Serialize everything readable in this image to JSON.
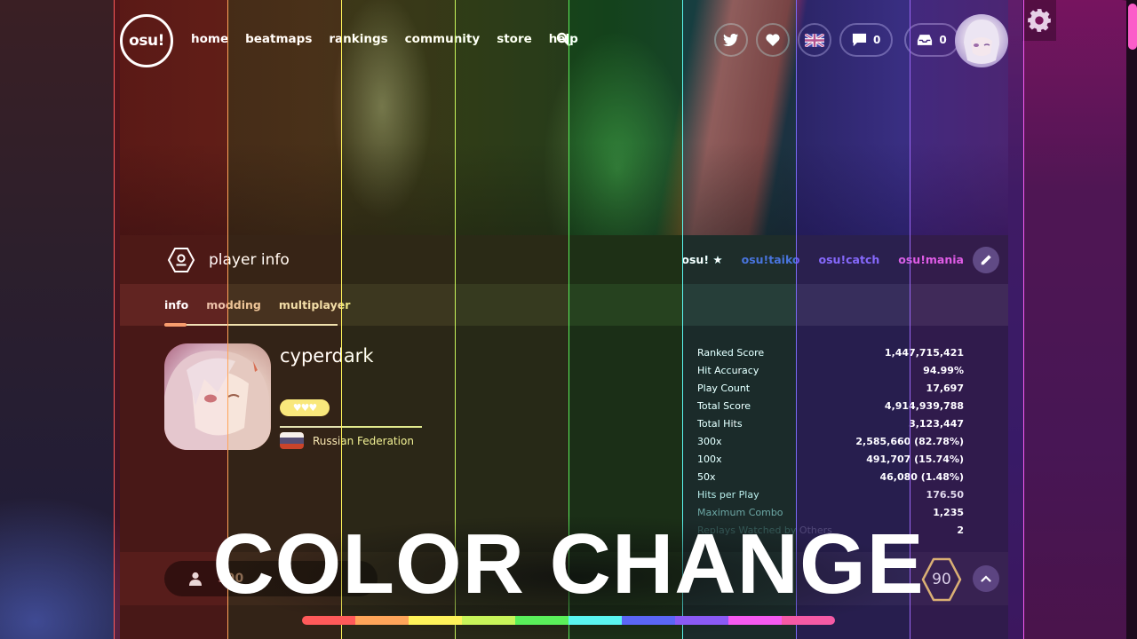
{
  "nav": {
    "logo": "osu!",
    "links": [
      "home",
      "beatmaps",
      "rankings",
      "community",
      "store",
      "help"
    ],
    "search_icon": "search-icon",
    "right": {
      "twitter_icon": "twitter-icon",
      "heart_icon": "heart-icon",
      "language_flag": "uk-flag-icon",
      "chat_count": "0",
      "notifications_count": "0"
    },
    "settings_icon": "gear-icon"
  },
  "panel": {
    "title": "player info",
    "modes": [
      {
        "label": "osu!",
        "color": "#ffffff",
        "active": true
      },
      {
        "label": "osu!taiko",
        "color": "#6c5cff"
      },
      {
        "label": "osu!catch",
        "color": "#8a66ff"
      },
      {
        "label": "osu!mania",
        "color": "#ff4fd8"
      }
    ],
    "tabs": [
      {
        "label": "info",
        "color": "#ffffff",
        "active": true
      },
      {
        "label": "modding",
        "color": "#e0c9a4"
      },
      {
        "label": "multiplayer",
        "color": "#e7e3a8"
      }
    ],
    "user": {
      "username": "cyperdark",
      "supporter_hearts": "♥♥♥",
      "country": "Russian Federation"
    },
    "stats": [
      {
        "key": "Ranked Score",
        "value": "1,447,715,421"
      },
      {
        "key": "Hit Accuracy",
        "value": "94.99%"
      },
      {
        "key": "Play Count",
        "value": "17,697"
      },
      {
        "key": "Total Score",
        "value": "4,914,939,788"
      },
      {
        "key": "Total Hits",
        "value": "3,123,447"
      },
      {
        "key": "300x",
        "value": "2,585,660 (82.78%)"
      },
      {
        "key": "100x",
        "value": "491,707 (15.74%)"
      },
      {
        "key": "50x",
        "value": "46,080 (1.48%)"
      },
      {
        "key": "Hits per Play",
        "value": "176.50"
      },
      {
        "key": "Maximum Combo",
        "value": "1,235"
      },
      {
        "key": "Replays Watched by Others",
        "value": "2"
      }
    ],
    "followers": "990",
    "level": "90"
  },
  "overlay": {
    "title": "COLOR CHANGE",
    "rainbow_colors": [
      "#ff5a5a",
      "#ffa55a",
      "#fff35a",
      "#c8f55a",
      "#5af05a",
      "#5af5f0",
      "#5a66f5",
      "#8a5af5",
      "#f55af0",
      "#f55aa5"
    ]
  },
  "column_colors": [
    "#ff5a5a",
    "#ffa55a",
    "#fff35a",
    "#c8f55a",
    "#5af05a",
    "#5af5f0",
    "#7a6af5",
    "#9a66f5",
    "#f55af0"
  ]
}
